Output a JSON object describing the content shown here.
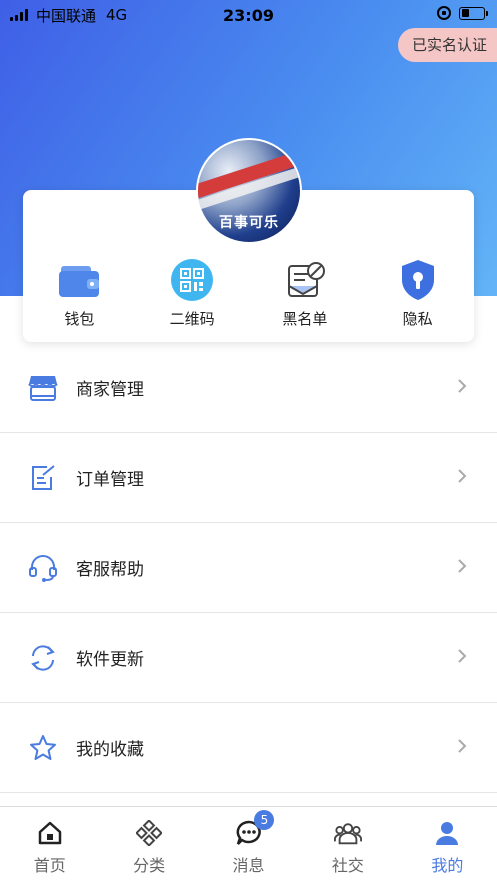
{
  "status_bar": {
    "carrier": "中国联通",
    "network": "4G",
    "time": "23:09",
    "battery_level": 0.35
  },
  "header": {
    "verify_badge": "已实名认证"
  },
  "avatar": {
    "logo_text": "百事可乐"
  },
  "quick_actions": [
    {
      "label": "钱包",
      "icon": "wallet-icon"
    },
    {
      "label": "二维码",
      "icon": "qrcode-icon"
    },
    {
      "label": "黑名单",
      "icon": "blacklist-icon"
    },
    {
      "label": "隐私",
      "icon": "privacy-shield-icon"
    }
  ],
  "menu": [
    {
      "label": "商家管理",
      "icon": "store-icon"
    },
    {
      "label": "订单管理",
      "icon": "order-edit-icon"
    },
    {
      "label": "客服帮助",
      "icon": "headset-icon"
    },
    {
      "label": "软件更新",
      "icon": "refresh-icon"
    },
    {
      "label": "我的收藏",
      "icon": "star-icon"
    }
  ],
  "tabbar": {
    "tabs": [
      {
        "label": "首页",
        "icon": "home-icon"
      },
      {
        "label": "分类",
        "icon": "category-icon"
      },
      {
        "label": "消息",
        "icon": "message-icon",
        "badge": "5"
      },
      {
        "label": "社交",
        "icon": "social-icon"
      },
      {
        "label": "我的",
        "icon": "profile-icon"
      }
    ],
    "active_index": 4
  },
  "colors": {
    "accent": "#4a7be0",
    "header_start": "#3f5fe6",
    "header_end": "#63b4f7",
    "badge_bg": "#f5c6c6"
  }
}
